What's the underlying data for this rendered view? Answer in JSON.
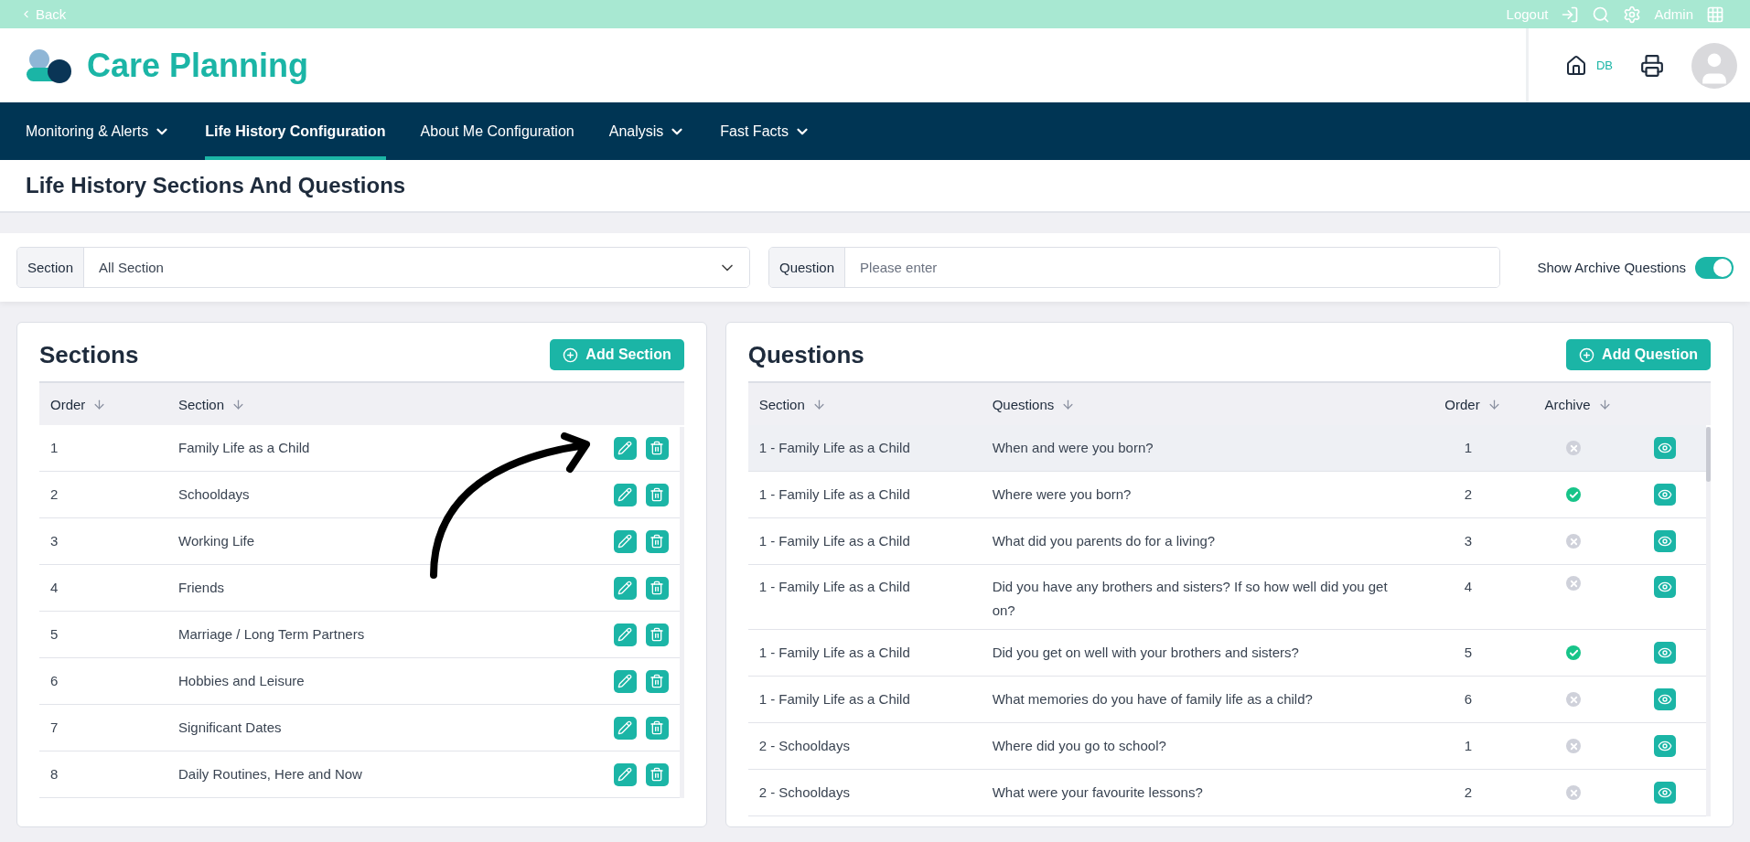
{
  "top_bar": {
    "back": "Back",
    "logout": "Logout",
    "user": "Admin"
  },
  "header": {
    "app_name": "Care Planning",
    "home_label": "DB"
  },
  "nav": [
    {
      "label": "Monitoring & Alerts",
      "dropdown": true,
      "selected": false
    },
    {
      "label": "Life History Configuration",
      "dropdown": false,
      "selected": true
    },
    {
      "label": "About Me Configuration",
      "dropdown": false,
      "selected": false
    },
    {
      "label": "Analysis",
      "dropdown": true,
      "selected": false
    },
    {
      "label": "Fast Facts",
      "dropdown": true,
      "selected": false
    }
  ],
  "page_title": "Life History Sections And Questions",
  "filters": {
    "section_label": "Section",
    "section_value": "All Section",
    "question_label": "Question",
    "question_placeholder": "Please enter",
    "archive_toggle_label": "Show Archive Questions",
    "archive_toggle_on": true
  },
  "sections_panel": {
    "title": "Sections",
    "add_button": "Add Section",
    "columns": [
      "Order",
      "Section"
    ],
    "rows": [
      {
        "order": "1",
        "section": "Family Life as a Child"
      },
      {
        "order": "2",
        "section": "Schooldays"
      },
      {
        "order": "3",
        "section": "Working Life"
      },
      {
        "order": "4",
        "section": "Friends"
      },
      {
        "order": "5",
        "section": "Marriage / Long Term Partners"
      },
      {
        "order": "6",
        "section": "Hobbies and Leisure"
      },
      {
        "order": "7",
        "section": "Significant Dates"
      },
      {
        "order": "8",
        "section": "Daily Routines, Here and Now"
      }
    ]
  },
  "questions_panel": {
    "title": "Questions",
    "add_button": "Add Question",
    "columns": [
      "Section",
      "Questions",
      "Order",
      "Archive"
    ],
    "rows": [
      {
        "section": "1 - Family Life as a Child",
        "question": "When and were you born?",
        "order": "1",
        "archived": false,
        "selected": true
      },
      {
        "section": "1 - Family Life as a Child",
        "question": "Where were you born?",
        "order": "2",
        "archived": true,
        "selected": false
      },
      {
        "section": "1 - Family Life as a Child",
        "question": "What did you parents do for a living?",
        "order": "3",
        "archived": false,
        "selected": false
      },
      {
        "section": "1 - Family Life as a Child",
        "question": "Did you have any brothers and sisters? If so how well did you get on?",
        "order": "4",
        "archived": false,
        "selected": false
      },
      {
        "section": "1 - Family Life as a Child",
        "question": "Did you get on well with your brothers and sisters?",
        "order": "5",
        "archived": true,
        "selected": false
      },
      {
        "section": "1 - Family Life as a Child",
        "question": "What memories do you have of family life as a child?",
        "order": "6",
        "archived": false,
        "selected": false
      },
      {
        "section": "2 - Schooldays",
        "question": "Where did you go to school?",
        "order": "1",
        "archived": false,
        "selected": false
      },
      {
        "section": "2 - Schooldays",
        "question": "What were your favourite lessons?",
        "order": "2",
        "archived": false,
        "selected": false
      }
    ]
  }
}
